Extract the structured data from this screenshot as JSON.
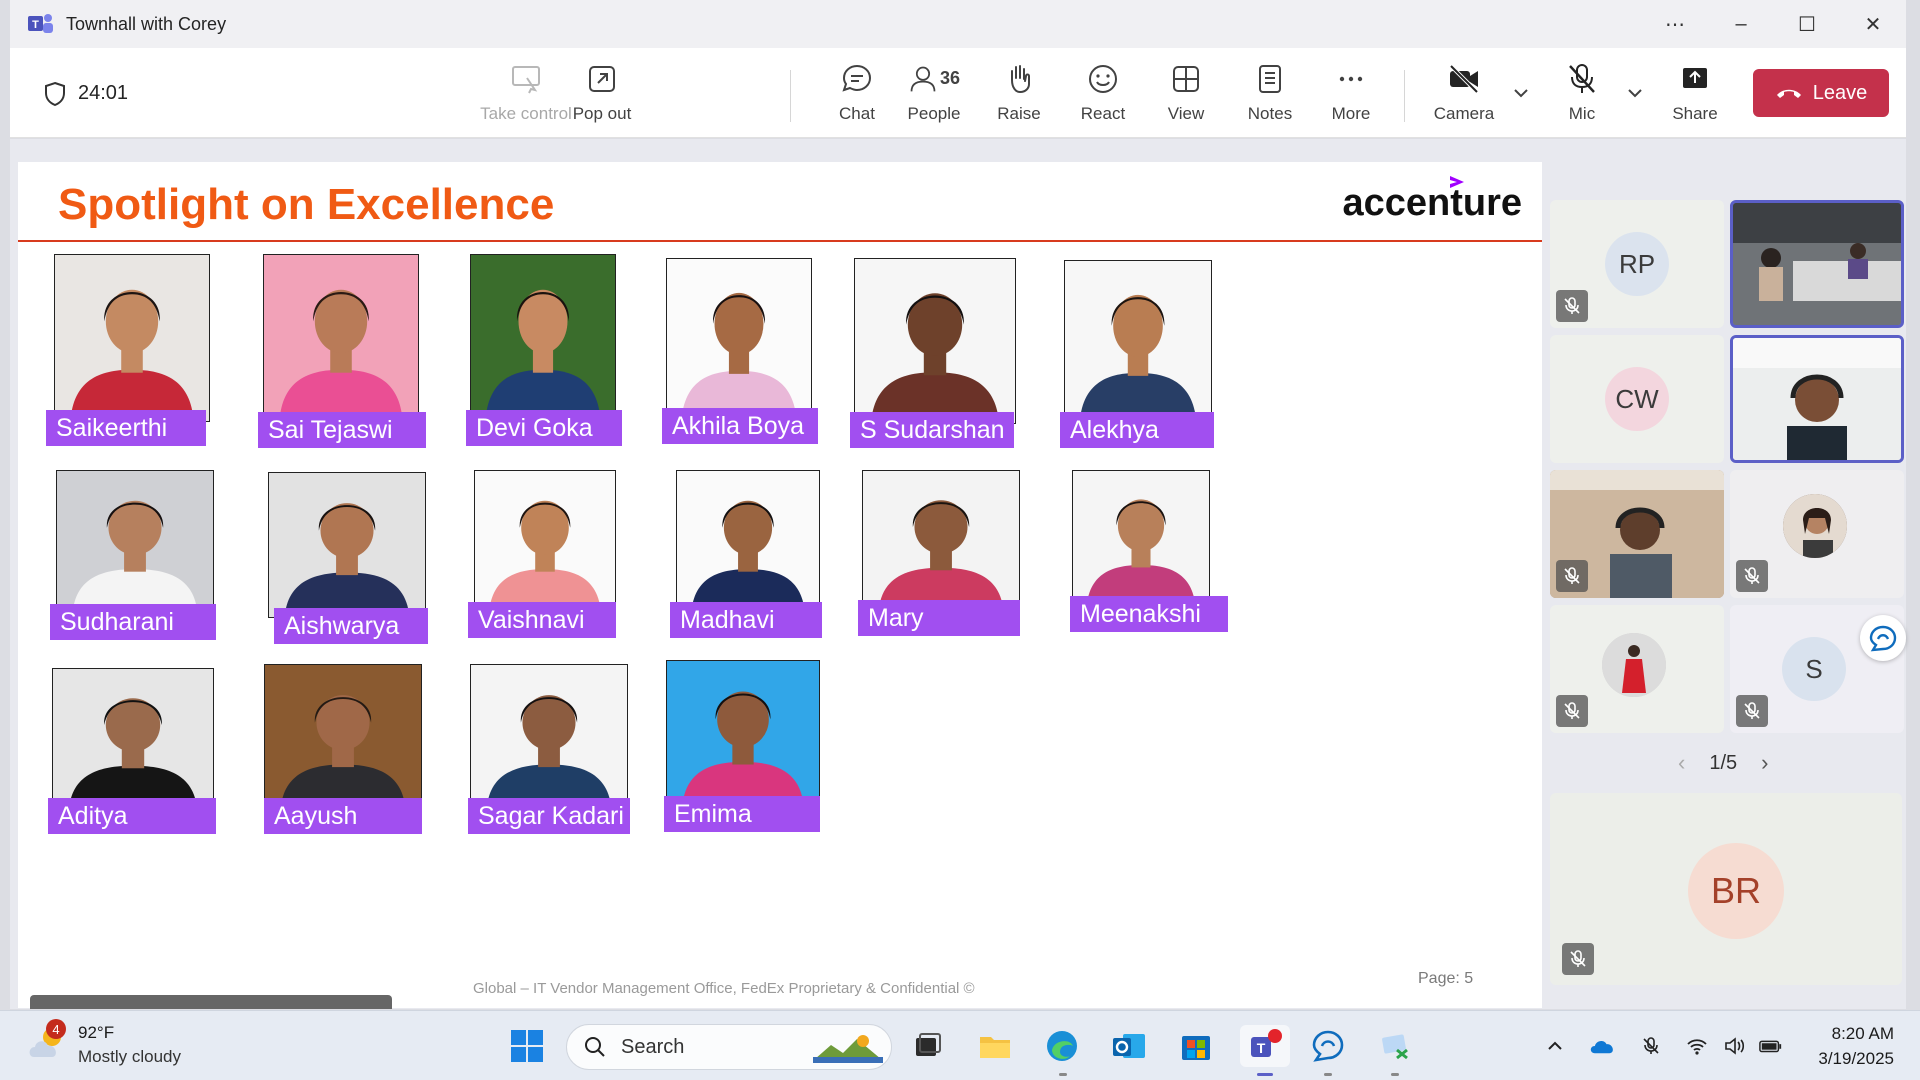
{
  "window": {
    "title": "Townhall with Corey"
  },
  "toolbar": {
    "timer": "24:01",
    "take_control": "Take control",
    "pop_out": "Pop out",
    "chat": "Chat",
    "people": "People",
    "people_count": "36",
    "raise": "Raise",
    "react": "React",
    "view": "View",
    "notes": "Notes",
    "more": "More",
    "camera": "Camera",
    "mic": "Mic",
    "share": "Share",
    "leave": "Leave"
  },
  "slide": {
    "title": "Spotlight on Excellence",
    "brand": "accenture",
    "footer": "Global – IT Vendor Management Office, FedEx Proprietary & Confidential ©",
    "page": "Page: 5",
    "people": [
      "Saikeerthi",
      "Sai Tejaswi",
      "Devi Goka",
      "Akhila Boya",
      "S Sudarshan",
      "Alekhya",
      "Sudharani",
      "Aishwarya",
      "Vaishnavi",
      "Madhavi",
      "Mary",
      "Meenakshi",
      "Aditya",
      "Aayush",
      "Sagar Kadari",
      "Emima"
    ]
  },
  "participants": {
    "tiles": [
      {
        "initials": "RP"
      },
      {
        "initials": "CW"
      },
      {
        "initials": "S"
      },
      {
        "initials": "BR"
      }
    ],
    "pager": "1/5"
  },
  "taskbar": {
    "weather_temp": "92°F",
    "weather_condition": "Mostly cloudy",
    "weather_badge": "4",
    "search_placeholder": "Search",
    "time": "8:20 AM",
    "date": "3/19/2025"
  },
  "colors": {
    "leave": "#c4314b",
    "title_orange": "#f05a14",
    "name_tag_purple": "#a14ff0",
    "teams_accent": "#5b5fc7"
  }
}
